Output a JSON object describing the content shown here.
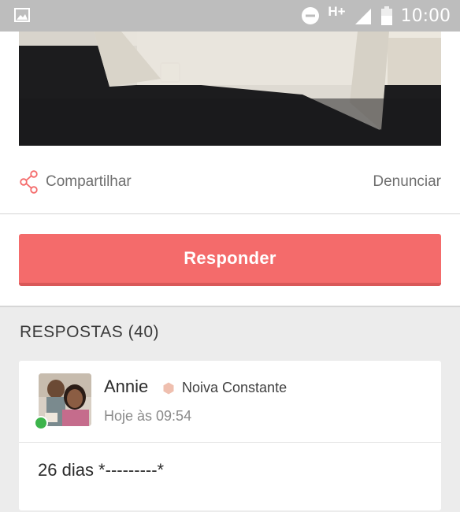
{
  "status_bar": {
    "time": "10:00",
    "network": "H+",
    "icons": [
      "image-notification-icon",
      "do-not-disturb-icon",
      "signal-icon",
      "battery-icon"
    ]
  },
  "post": {
    "share_label": "Compartilhar",
    "report_label": "Denunciar"
  },
  "reply_button_label": "Responder",
  "answers": {
    "header": "RESPOSTAS (40)",
    "items": [
      {
        "user": "Annie",
        "badge": "Noiva Constante",
        "time": "Hoje às 09:54",
        "text": "26 dias *---------*"
      }
    ]
  },
  "colors": {
    "accent": "#f46b6b",
    "online": "#3cb44b",
    "badge": "#efbfaf",
    "status_bar": "#bdbdbd"
  }
}
